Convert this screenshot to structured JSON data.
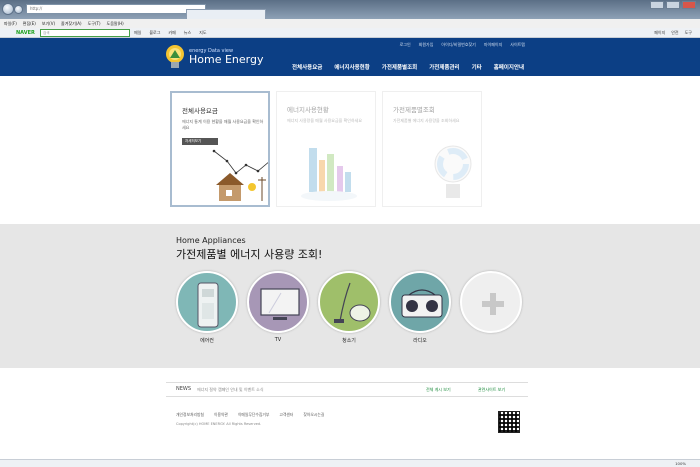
{
  "browser": {
    "address": "http://",
    "tab_title": "",
    "menu": [
      "파일(F)",
      "편집(E)",
      "보기(V)",
      "즐겨찾기(A)",
      "도구(T)",
      "도움말(H)"
    ],
    "toolbar_brand": "NAVER",
    "toolbar_search_placeholder": "검색",
    "toolbar_items": [
      "메일",
      "블로그",
      "카페",
      "뉴스",
      "지도"
    ],
    "toolbar_right": [
      "페이지",
      "안전",
      "도구"
    ],
    "zoom": "100%"
  },
  "site": {
    "logo_sub": "energy Data view",
    "logo_main": "Home Energy",
    "top_links": [
      "로그인",
      "회원가입",
      "아이디/비밀번호찾기",
      "마이페이지",
      "사이트맵"
    ],
    "nav": [
      "전체사용요금",
      "에너지사용현황",
      "가전제품별조회",
      "가전제품관리",
      "기타",
      "홈페이지안내"
    ]
  },
  "cards": [
    {
      "title": "전체사용요금",
      "desc": "에너지 통계 이용 현황을 매월 사용요금을 확인하세요",
      "button": "자세히보기"
    },
    {
      "title": "에너지사용현황",
      "desc": "에너지 사용량을 매월 사용요금을 확인하세요",
      "button": ""
    },
    {
      "title": "가전제품별조회",
      "desc": "가전제품별 에너지 사용량을 조회하세요",
      "button": ""
    }
  ],
  "appliances": {
    "title_en": "Home Appliances",
    "title_ko": "가전제품별 에너지 사용량 조회!",
    "items": [
      {
        "label": "에어컨",
        "color": "#7fb7b6"
      },
      {
        "label": "TV",
        "color": "#a797b6"
      },
      {
        "label": "청소기",
        "color": "#9fbf6a"
      },
      {
        "label": "라디오",
        "color": "#6fa6a8"
      },
      {
        "label": "",
        "color": "#efefef"
      }
    ]
  },
  "news": {
    "label": "NEWS",
    "text": "에너지 절약 캠페인 안내 및 이벤트 소식",
    "all": "전체 게시 보기",
    "related": "관련사이트 보기"
  },
  "footer": {
    "links": [
      "개인정보처리방침",
      "이용약관",
      "이메일무단수집거부",
      "고객센터",
      "찾아오시는길"
    ],
    "copyright": "Copyright(c) HOME ENERGY. All Rights Reserved."
  }
}
